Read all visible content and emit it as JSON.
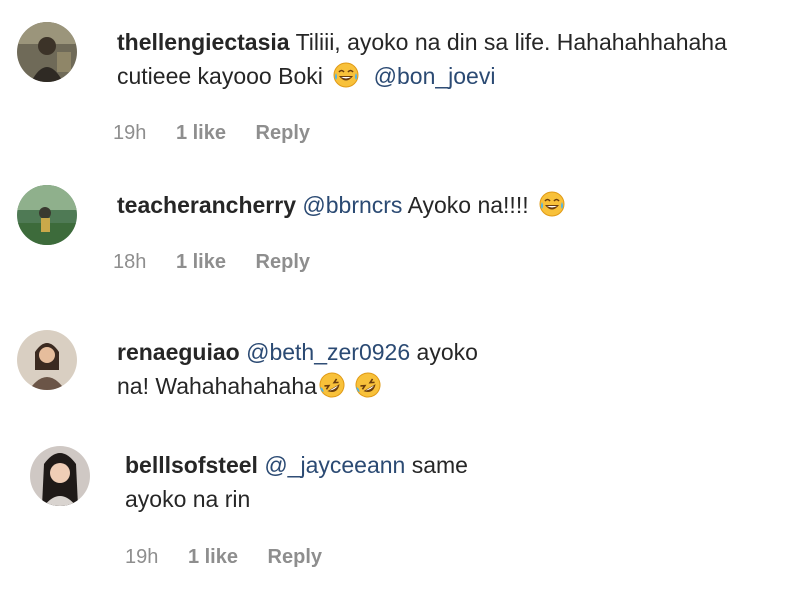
{
  "comments": [
    {
      "username": "thellengiectasia",
      "text_1": "Tiliii, ayoko na din sa life. Hahahahhahaha",
      "text_2": "cutieee kayooo Boki",
      "emoji": "face-with-tears-of-joy-icon",
      "mention": "@bon_joevi",
      "time": "19h",
      "likes": "1 like",
      "reply": "Reply"
    },
    {
      "username": "teacherancherry",
      "mention": "@bbrncrs",
      "text_1": "Ayoko na!!!!",
      "emoji": "face-with-tears-of-joy-icon",
      "time": "18h",
      "likes": "1 like",
      "reply": "Reply"
    },
    {
      "username": "renaeguiao",
      "mention": "@beth_zer0926",
      "text_1": "ayoko",
      "text_2": "na! Wahahahahaha",
      "emoji": "rolling-on-floor-laughing-icon",
      "time": "",
      "likes": "",
      "reply": ""
    },
    {
      "username": "belllsofsteel",
      "mention": "@_jayceeann",
      "text_1": "same",
      "text_2": "ayoko na rin",
      "time": "19h",
      "likes": "1 like",
      "reply": "Reply"
    }
  ],
  "colors": {
    "text": "#262626",
    "mention": "#2b4a73",
    "meta": "#8e8e8e",
    "emoji": "#f6b93b"
  }
}
